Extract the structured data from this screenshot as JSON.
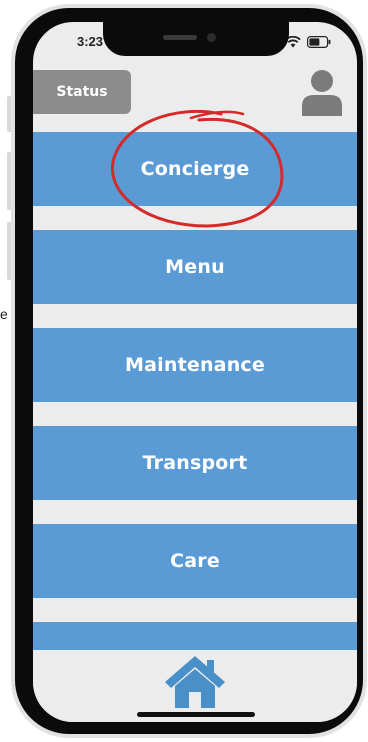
{
  "edge_text": "e",
  "status_bar": {
    "time": "3:23",
    "wifi_icon": "wifi-icon",
    "battery_icon": "battery-icon"
  },
  "header": {
    "status_button_label": "Status",
    "avatar_icon": "user-avatar-icon"
  },
  "menu": {
    "items": [
      {
        "label": "Concierge"
      },
      {
        "label": "Menu"
      },
      {
        "label": "Maintenance"
      },
      {
        "label": "Transport"
      },
      {
        "label": "Care"
      },
      {
        "label": ""
      }
    ]
  },
  "bottom_nav": {
    "home_icon": "home-icon"
  },
  "annotation": {
    "highlight_color": "#d42a2a",
    "highlighted_item": "Concierge"
  },
  "colors": {
    "menu_item_bg": "#5b9bd5",
    "status_button_bg": "#8c8c8c",
    "home_icon_color": "#4a90c8",
    "screen_bg": "#ececec"
  }
}
